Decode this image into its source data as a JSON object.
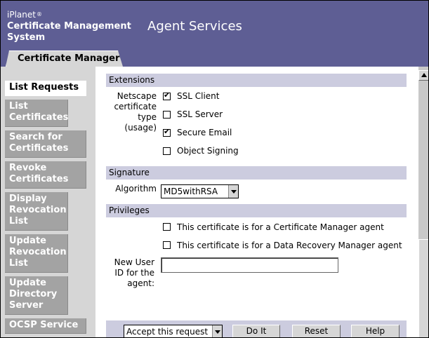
{
  "header": {
    "brand_small": "iPlanet",
    "brand_mark": "®",
    "brand_line1": "Certificate Management",
    "brand_line2": "System",
    "title": "Agent Services",
    "tab": "Certificate Manager",
    "bg_color": "#5e5e94"
  },
  "sidebar": {
    "items": [
      {
        "label": "List Requests",
        "active": true
      },
      {
        "label": "List Certificates"
      },
      {
        "label": "Search for Certificates"
      },
      {
        "label": "Revoke Certificates"
      },
      {
        "label": "Display Revocation List"
      },
      {
        "label": "Update Revocation List"
      },
      {
        "label": "Update Directory Server"
      },
      {
        "label": "OCSP Service"
      }
    ]
  },
  "extensions": {
    "section_title": "Extensions",
    "type_label": "Netscape certificate type (usage)",
    "options": [
      {
        "label": "SSL Client",
        "checked": true
      },
      {
        "label": "SSL Server",
        "checked": false
      },
      {
        "label": "Secure Email",
        "checked": true
      },
      {
        "label": "Object Signing",
        "checked": false
      }
    ]
  },
  "signature": {
    "section_title": "Signature",
    "algorithm_label": "Algorithm",
    "algorithm_value": "MD5withRSA"
  },
  "privileges": {
    "section_title": "Privileges",
    "options": [
      {
        "label": "This certificate is for a Certificate Manager agent",
        "checked": false
      },
      {
        "label": "This certificate is for a Data Recovery Manager agent",
        "checked": false
      }
    ],
    "new_user_label": "New User ID for the agent:",
    "new_user_value": ""
  },
  "actions": {
    "action_select": "Accept this request",
    "do_it": "Do It",
    "reset": "Reset",
    "help": "Help"
  },
  "colors": {
    "section_bar": "#ccccdf",
    "sidebar_bg": "#d6d6d6",
    "sidebar_item": "#a3a3a3"
  }
}
